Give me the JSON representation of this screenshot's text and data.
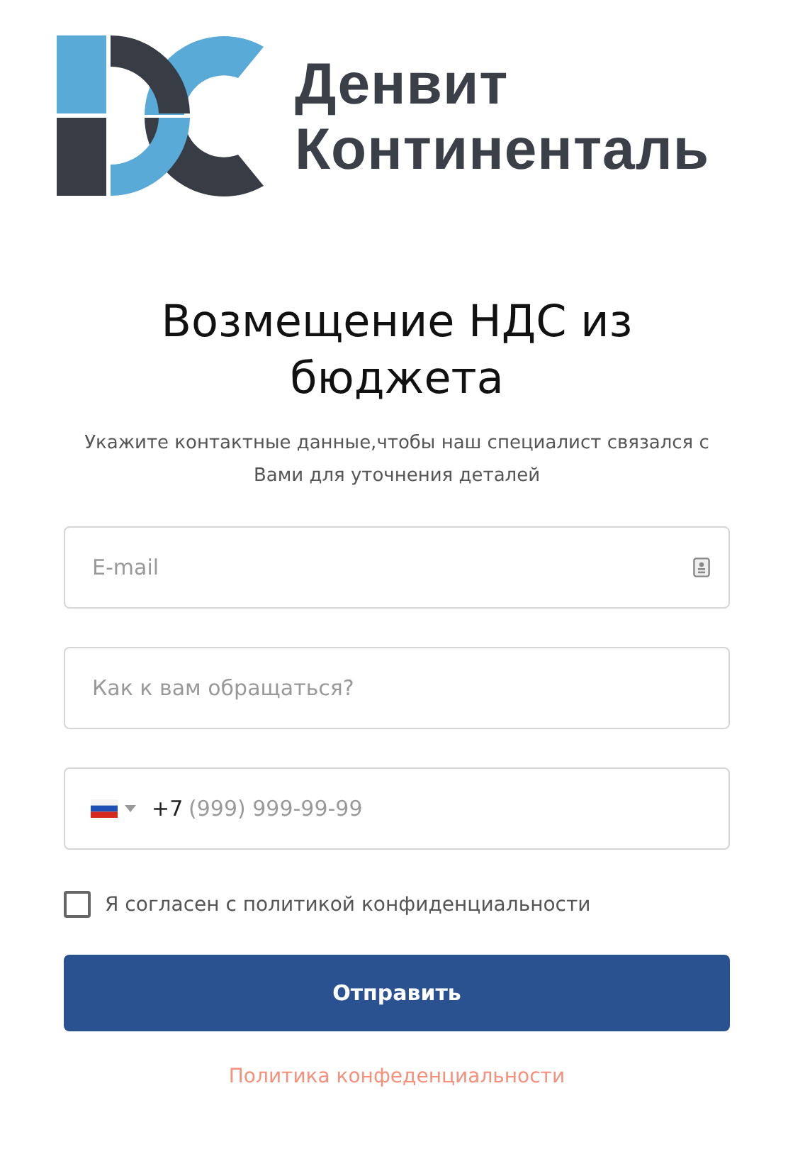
{
  "logo": {
    "line1": "Денвит",
    "line2": "Континенталь"
  },
  "title": "Возмещение НДС из бюджета",
  "subtitle": "Укажите контактные данные,чтобы наш специалист связался с Вами для уточнения деталей",
  "fields": [
    {
      "kind": "email",
      "placeholder": "E-mail"
    },
    {
      "kind": "text",
      "placeholder": "Как к вам обращаться?"
    },
    {
      "kind": "phone",
      "prefix": "+7",
      "placeholder": "(999) 999-99-99"
    }
  ],
  "consent": {
    "label": "Я согласен с политикой конфиденциальности",
    "checked": false
  },
  "submit": "Отправить",
  "policy_link": "Политика конфеденциальности"
}
